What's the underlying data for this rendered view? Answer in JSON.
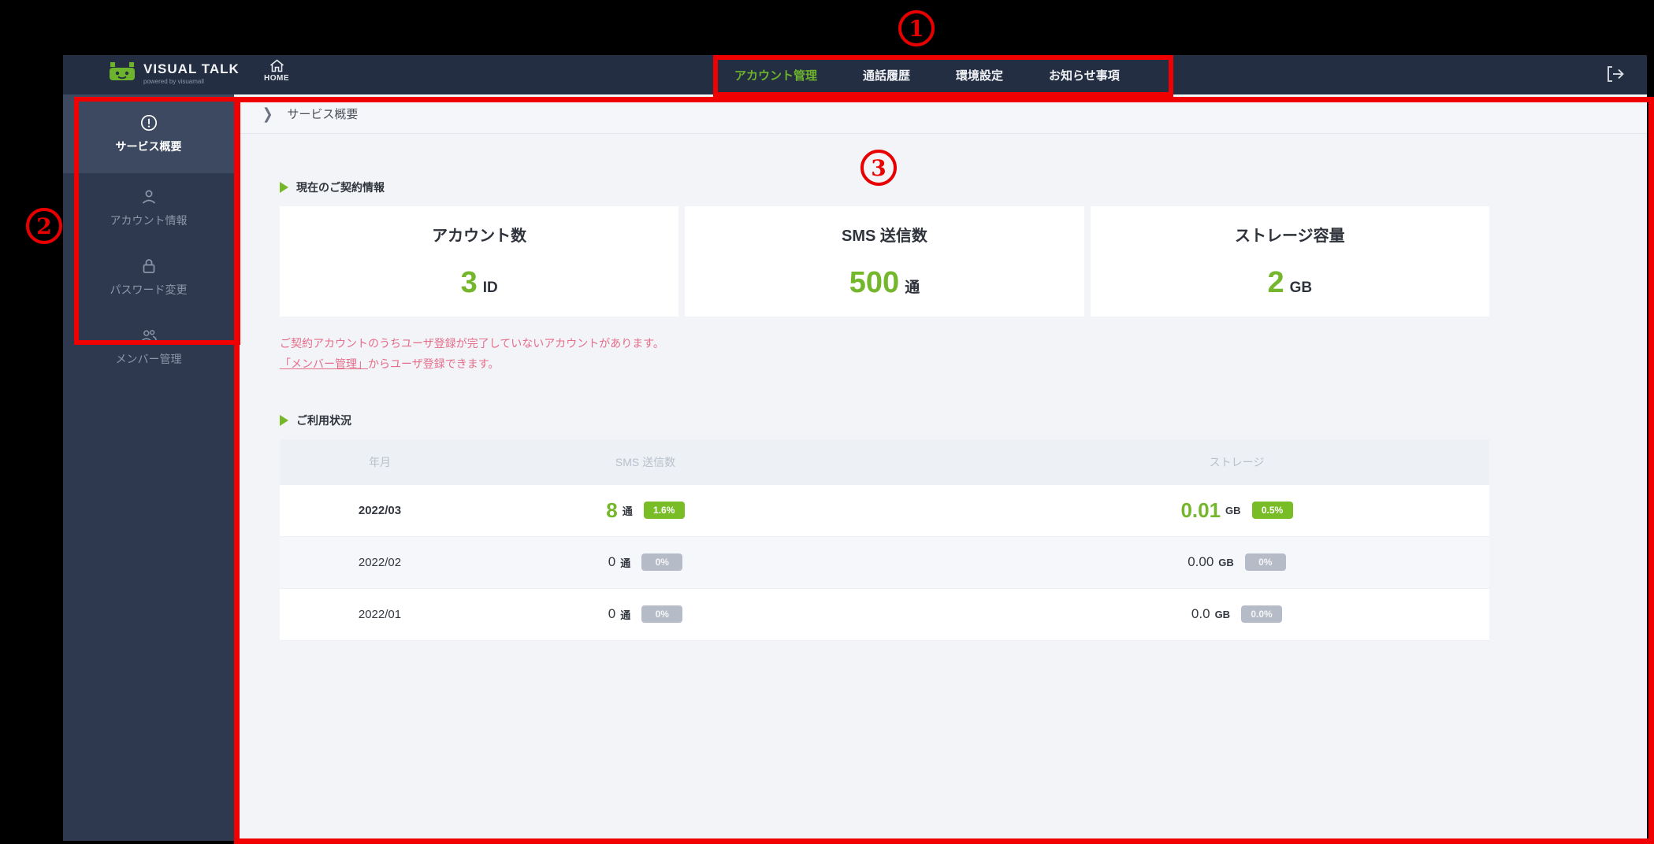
{
  "topbar": {
    "logo_title": "VISUAL TALK",
    "logo_subtitle": "powered by visuamall",
    "home_label": "HOME",
    "nav_items": [
      {
        "label": "アカウント管理",
        "active": true
      },
      {
        "label": "通話履歴",
        "active": false
      },
      {
        "label": "環境設定",
        "active": false
      },
      {
        "label": "お知らせ事項",
        "active": false
      }
    ]
  },
  "sidebar": {
    "items": [
      {
        "label": "サービス概要",
        "icon": "info-circle-icon",
        "active": true
      },
      {
        "label": "アカウント情報",
        "icon": "person-icon",
        "active": false
      },
      {
        "label": "パスワード変更",
        "icon": "lock-icon",
        "active": false
      },
      {
        "label": "メンバー管理",
        "icon": "people-icon",
        "active": false
      }
    ]
  },
  "main": {
    "breadcrumb": "サービス概要",
    "contract_section": {
      "title": "現在のご契約情報",
      "cards": [
        {
          "label": "アカウント数",
          "value": "3",
          "unit": "ID"
        },
        {
          "label": "SMS 送信数",
          "value": "500",
          "unit": "通"
        },
        {
          "label": "ストレージ容量",
          "value": "2",
          "unit": "GB"
        }
      ],
      "warning_line1": "ご契約アカウントのうちユーザ登録が完了していないアカウントがあります。",
      "warning_link": "「メンバー管理」",
      "warning_line2_rest": "からユーザ登録できます。"
    },
    "usage_section": {
      "title": "ご利用状況",
      "table": {
        "headers": [
          "年月",
          "SMS 送信数",
          "ストレージ"
        ],
        "rows": [
          {
            "month": "2022/03",
            "sms_value": "8",
            "sms_unit": "通",
            "sms_pct": "1.6%",
            "storage_value": "0.01",
            "storage_unit": "GB",
            "storage_pct": "0.5%",
            "highlight": true
          },
          {
            "month": "2022/02",
            "sms_value": "0",
            "sms_unit": "通",
            "sms_pct": "0%",
            "storage_value": "0.00",
            "storage_unit": "GB",
            "storage_pct": "0%",
            "highlight": false
          },
          {
            "month": "2022/01",
            "sms_value": "0",
            "sms_unit": "通",
            "sms_pct": "0%",
            "storage_value": "0.0",
            "storage_unit": "GB",
            "storage_pct": "0.0%",
            "highlight": false
          }
        ]
      }
    }
  },
  "annotations": {
    "label1": "1",
    "label2": "2",
    "label3": "3",
    "box_color": "#f00000"
  },
  "colors": {
    "accent_green": "#74b62c",
    "badge_green": "#79bd26",
    "badge_gray": "#b6bcc7",
    "warning_pink": "#e56e8a",
    "topbar_bg": "#232e42",
    "sidebar_bg": "#2e3950",
    "content_bg": "#f2f4f8"
  }
}
